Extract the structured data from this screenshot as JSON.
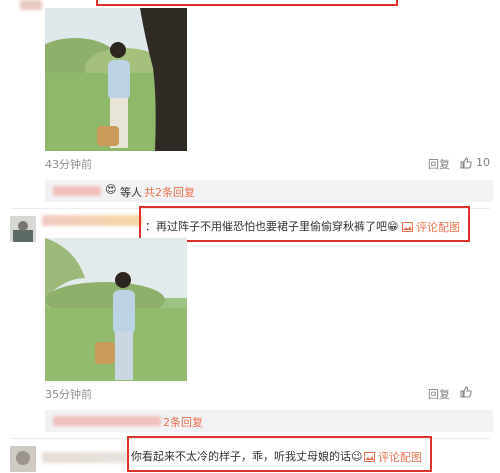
{
  "comments": [
    {
      "time": "43分钟前",
      "reply_label": "回复",
      "like_count": "10",
      "sub_suffix": "等人",
      "sub_count": "共2条回复"
    },
    {
      "text": "：再过阵子不用催恐怕也要裙子里偷偷穿秋裤了吧",
      "emoji": "😁",
      "image_link": "评论配图",
      "time": "35分钟前",
      "reply_label": "回复",
      "sub_count": "2条回复"
    },
    {
      "text": "你看起来不太冷的样子，乖，听我丈母娘的话",
      "emoji": "😉",
      "image_link": "评论配图"
    }
  ],
  "colors": {
    "highlight": "#e0322b",
    "link": "#eb7350"
  }
}
